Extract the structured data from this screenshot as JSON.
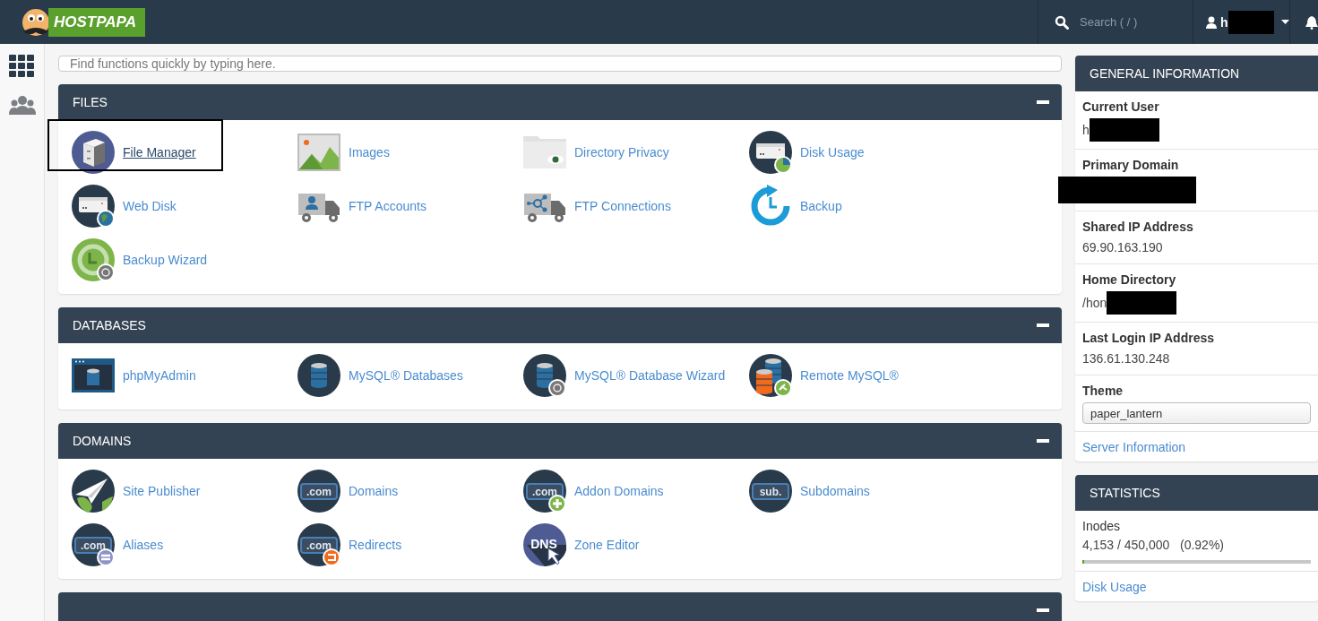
{
  "header": {
    "logo": "HOSTPAPA",
    "search": {
      "placeholder": "Search ( / )"
    },
    "user": {
      "name": "h",
      "redacted": true
    }
  },
  "sidebar": {
    "items": [
      {
        "selected": true
      },
      {
        "selected": false
      }
    ]
  },
  "search": {
    "placeholder": "Find functions quickly by typing here."
  },
  "sections": [
    {
      "title": "FILES",
      "expanded": true,
      "items": [
        {
          "label": "File Manager",
          "highlighted": true
        },
        {
          "label": "Images",
          "highlighted": false
        },
        {
          "label": "Directory Privacy",
          "highlighted": false
        },
        {
          "label": "Disk Usage",
          "highlighted": false
        },
        {
          "label": "Web Disk",
          "highlighted": false
        },
        {
          "label": "FTP Accounts",
          "highlighted": false
        },
        {
          "label": "FTP Connections",
          "highlighted": false
        },
        {
          "label": "Backup",
          "highlighted": false
        },
        {
          "label": "Backup Wizard",
          "highlighted": false
        }
      ]
    },
    {
      "title": "DATABASES",
      "expanded": true,
      "items": [
        {
          "label": "phpMyAdmin",
          "highlighted": false
        },
        {
          "label": "MySQL® Databases",
          "highlighted": false
        },
        {
          "label": "MySQL® Database Wizard",
          "highlighted": false
        },
        {
          "label": "Remote MySQL®",
          "highlighted": false
        }
      ]
    },
    {
      "title": "DOMAINS",
      "expanded": true,
      "items": [
        {
          "label": "Site Publisher",
          "highlighted": false
        },
        {
          "label": "Domains",
          "highlighted": false,
          "icon_text": ".com"
        },
        {
          "label": "Addon Domains",
          "highlighted": false,
          "icon_text": ".com"
        },
        {
          "label": "Subdomains",
          "highlighted": false,
          "icon_text": "sub."
        },
        {
          "label": "Aliases",
          "highlighted": false,
          "icon_text": ".com"
        },
        {
          "label": "Redirects",
          "highlighted": false,
          "icon_text": ".com"
        },
        {
          "label": "Zone Editor",
          "highlighted": false,
          "icon_text": "DNS"
        }
      ]
    },
    {
      "expanded": true
    }
  ],
  "general_information": {
    "title": "GENERAL INFORMATION",
    "rows": [
      {
        "kind": "text",
        "label": "Current User",
        "value": "h",
        "redacted": true
      },
      {
        "kind": "text",
        "label": "Primary Domain",
        "redacted": true
      },
      {
        "kind": "text",
        "label": "Shared IP Address",
        "value": "69.90.163.190"
      },
      {
        "kind": "text",
        "label": "Home Directory",
        "value": "/hon",
        "redacted": true
      },
      {
        "kind": "text",
        "label": "Last Login IP Address",
        "value": "136.61.130.248"
      },
      {
        "kind": "select",
        "label": "Theme",
        "value": "paper_lantern"
      },
      {
        "kind": "link",
        "value": "Server Information"
      }
    ]
  },
  "statistics": {
    "title": "STATISTICS",
    "rows": [
      {
        "kind": "meter",
        "label": "Inodes",
        "value": "4,153 / 450,000   (0.92%)",
        "level": 0.0092
      },
      {
        "kind": "link",
        "value": "Disk Usage"
      }
    ]
  }
}
